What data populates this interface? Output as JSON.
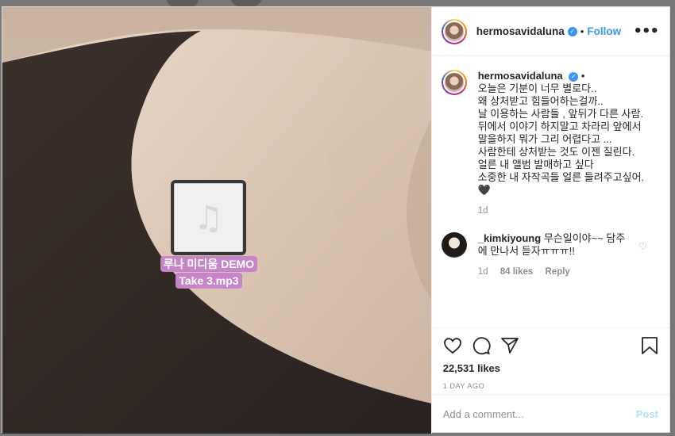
{
  "post": {
    "username": "hermosavidaluna",
    "follow_label": "Follow",
    "more_icon": "more-horizontal-icon",
    "verified_icon": "verified-badge-icon",
    "separator": "•"
  },
  "media": {
    "audio_icon": "music-note-icon",
    "caption_lines": [
      "루나 미디움 DEMO",
      "Take 3.mp3"
    ]
  },
  "caption": {
    "username": "hermosavidaluna",
    "separator": "•",
    "text": "오늘은 기분이 너무 별로다..\n왜 상처받고 힘들어하는걸까..\n날 이용하는 사람들 , 앞뒤가 다른 사람.\n뒤에서 이야기 하지말고 차라리 앞에서\n말을하지 뭐가 그리 어렵다고 ...\n사람한테 상처받는 것도 이젠 질린다.\n얼른 내 앨범 발매하고 싶다\n소중한 내 자작곡들 얼른 들려주고싶어. 🖤",
    "age": "1d"
  },
  "comments": [
    {
      "username": "_kimkiyoung",
      "text": "무슨일이야~~ 담주에 만나서 듣자ㅠㅠㅠ!!",
      "age": "1d",
      "likes": "84 likes",
      "reply_label": "Reply"
    }
  ],
  "actions": {
    "icons": [
      "heart-icon",
      "comment-icon",
      "share-icon",
      "bookmark-icon"
    ],
    "likes": "22,531 likes",
    "time_ago": "1 DAY AGO"
  },
  "add_comment": {
    "placeholder": "Add a comment...",
    "post_label": "Post"
  }
}
